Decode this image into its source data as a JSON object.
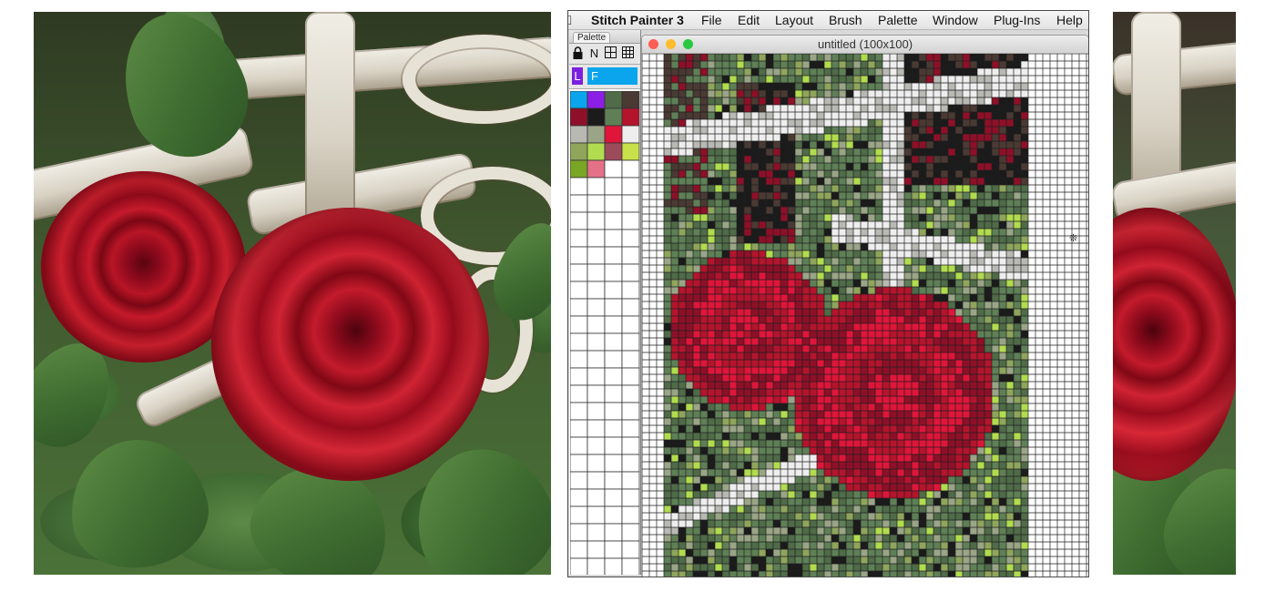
{
  "app": {
    "name": "Stitch Painter 3",
    "menus": [
      "File",
      "Edit",
      "Layout",
      "Brush",
      "Palette",
      "Window",
      "Plug-Ins",
      "Help"
    ]
  },
  "palette_panel": {
    "tab_label": "Palette",
    "tools": [
      "lock-icon",
      "N",
      "grid-icon",
      "pattern-grid-icon"
    ],
    "layer_label": "L",
    "field_label": "F",
    "colors": [
      "#0aa5ec",
      "#8c1fe6",
      "#4f6b48",
      "#4a3a33",
      "#8e1028",
      "#1b1b1b",
      "#5f8057",
      "#b5142d",
      "#b9b9b4",
      "#9aa587",
      "#e0153a",
      "#eeeeee",
      "#8fa55c",
      "#b2dc4f",
      "#9b4b5a",
      "#c8e04a",
      "#7aa626",
      "#e47187"
    ]
  },
  "document": {
    "title": "untitled (100x100)"
  },
  "colors": {
    "window_border": "#4a4a4a",
    "close": "#fd5f57",
    "minimize": "#febc2e",
    "zoom": "#28c840",
    "grid_line": "#1e1e1e"
  }
}
